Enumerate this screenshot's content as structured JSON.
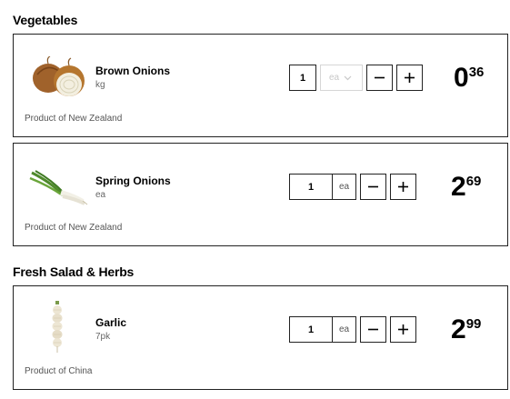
{
  "sections": [
    {
      "title": "Vegetables",
      "products": [
        {
          "name": "Brown Onions",
          "unit": "kg",
          "origin": "Product of New Zealand",
          "quantity": "1",
          "unit_option": "ea",
          "unit_option_disabled": true,
          "price_dollars": "0",
          "price_cents": "36",
          "image_icon": "brown-onion-image"
        },
        {
          "name": "Spring Onions",
          "unit": "ea",
          "origin": "Product of New Zealand",
          "quantity": "1",
          "unit_option": "ea",
          "unit_option_disabled": false,
          "price_dollars": "2",
          "price_cents": "69",
          "image_icon": "spring-onion-image"
        }
      ]
    },
    {
      "title": "Fresh Salad & Herbs",
      "products": [
        {
          "name": "Garlic",
          "unit": "7pk",
          "origin": "Product of China",
          "quantity": "1",
          "unit_option": "ea",
          "unit_option_disabled": false,
          "price_dollars": "2",
          "price_cents": "99",
          "image_icon": "garlic-image"
        }
      ]
    }
  ]
}
